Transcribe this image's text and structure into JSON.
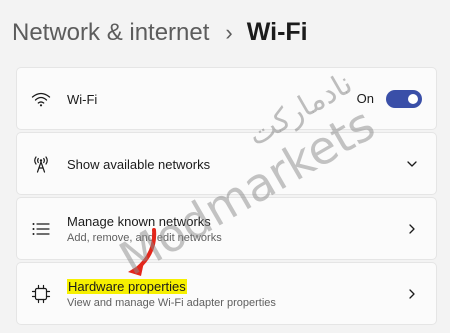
{
  "breadcrumb": {
    "parent": "Network & internet",
    "separator": "›",
    "current": "Wi-Fi"
  },
  "rows": [
    {
      "id": "wifi",
      "icon": "wifi-icon",
      "title": "Wi-Fi",
      "toggle_label": "On",
      "toggle_on": true
    },
    {
      "id": "available",
      "icon": "antenna-icon",
      "title": "Show available networks",
      "chevron": "chevron-down-icon"
    },
    {
      "id": "known",
      "icon": "list-icon",
      "title": "Manage known networks",
      "subtitle": "Add, remove, and edit networks",
      "chevron": "chevron-right-icon"
    },
    {
      "id": "hardware",
      "icon": "chip-icon",
      "title": "Hardware properties",
      "subtitle": "View and manage Wi-Fi adapter properties",
      "chevron": "chevron-right-icon",
      "highlighted": true
    }
  ],
  "watermark": {
    "text_latin": "Modmarkets",
    "text_arabic": "نادمارکت"
  },
  "colors": {
    "accent": "#3a4fa8",
    "highlight": "#f6f000",
    "arrow": "#e3261b",
    "background": "#f3f3f3",
    "card": "#fbfbfb"
  }
}
